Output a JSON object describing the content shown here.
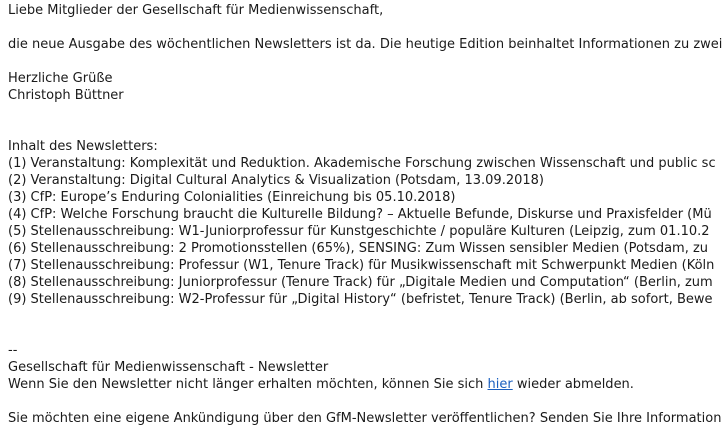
{
  "greeting": "Liebe Mitglieder der Gesellschaft für Medienwissenschaft,",
  "intro": "die neue Ausgabe des wöchentlichen Newsletters ist da. Die heutige Edition beinhaltet Informationen zu zwei",
  "closing": "Herzliche Grüße",
  "sender": "Christoph Büttner",
  "toc_heading": "Inhalt des Newsletters:",
  "toc_items": [
    "(1) Veranstaltung: Komplexität und Reduktion. Akademische Forschung zwischen Wissenschaft und public sc",
    "(2) Veranstaltung: Digital Cultural Analytics & Visualization (Potsdam, 13.09.2018)",
    "(3) CfP: Europe’s Enduring Colonialities (Einreichung bis 05.10.2018)",
    "(4) CfP: Welche Forschung braucht die Kulturelle Bildung? – Aktuelle Befunde, Diskurse und Praxisfelder (Mü",
    "(5) Stellenausschreibung: W1-Juniorprofessur für Kunstgeschichte / populäre Kulturen (Leipzig, zum 01.10.2",
    "(6) Stellenausschreibung: 2 Promotionsstellen (65%), SENSING: Zum Wissen sensibler Medien (Potsdam, zu",
    "(7) Stellenausschreibung: Professur (W1, Tenure Track) für Musikwissenschaft mit Schwerpunkt Medien (Köln",
    "(8) Stellenausschreibung: Juniorprofessur (Tenure Track) für „Digitale Medien und Computation“ (Berlin, zum",
    "(9) Stellenausschreibung: W2-Professur für „Digital History“ (befristet, Tenure Track) (Berlin, ab sofort, Bewe"
  ],
  "signature_separator": "--",
  "footer_org": "Gesellschaft für Medienwissenschaft - Newsletter",
  "unsubscribe": {
    "before": "Wenn Sie den Newsletter nicht länger erhalten möchten, können Sie sich ",
    "link": "hier",
    "after": " wieder abmelden."
  },
  "submit_notice": "Sie möchten eine eigene Ankündigung über den GfM-Newsletter veröffentlichen? Senden Sie Ihre Information"
}
